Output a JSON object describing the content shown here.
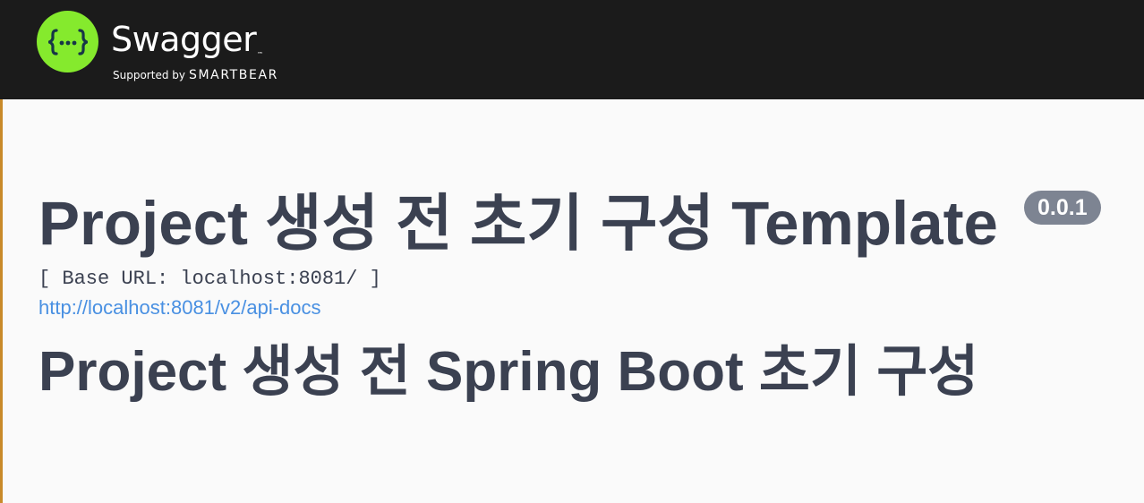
{
  "topbar": {
    "brand_name": "Swagger",
    "trademark": "™",
    "supported_by": "Supported by",
    "company": "SMARTBEAR",
    "colors": {
      "background": "#1b1b1b",
      "logo_circle": "#85ea2d",
      "logo_glyph": "#173647"
    },
    "logo_icon": "swagger-braces-icon"
  },
  "info": {
    "title": "Project 생성 전 초기 구성 Template",
    "version": "0.0.1",
    "base_url": "[ Base URL: localhost:8081/ ]",
    "docs_link": "http://localhost:8081/v2/api-docs",
    "description": "Project 생성 전 Spring Boot 초기 구성",
    "colors": {
      "text": "#3b4151",
      "link": "#4990e2",
      "version_badge": "#7d8492",
      "page_background": "#fafafa"
    }
  }
}
